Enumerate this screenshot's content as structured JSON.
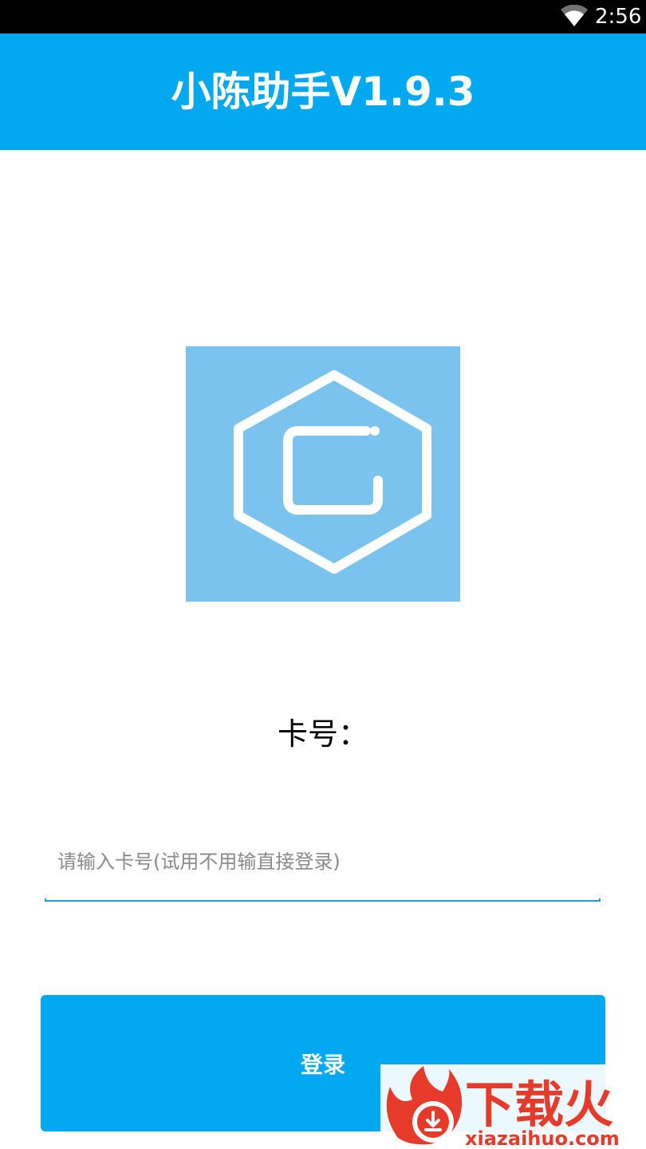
{
  "status_bar": {
    "time": "2:56",
    "wifi_icon": "wifi-icon"
  },
  "header": {
    "title": "小陈助手V1.9.3",
    "background_color": "#03A9F0"
  },
  "logo": {
    "icon": "hexagon-c-logo-icon",
    "background_color": "#7AC3EF"
  },
  "form": {
    "card_label": "卡号：",
    "card_input_placeholder": "请输入卡号(试用不用输直接登录)",
    "card_input_value": "",
    "login_label": "登录"
  },
  "watermark": {
    "text": "下载火",
    "url_text": "xiazaihuo.com",
    "icon": "flame-download-icon"
  },
  "colors": {
    "accent": "#03A9F0",
    "input_underline": "#1E9FD3",
    "watermark_red": "#E63A2B"
  }
}
